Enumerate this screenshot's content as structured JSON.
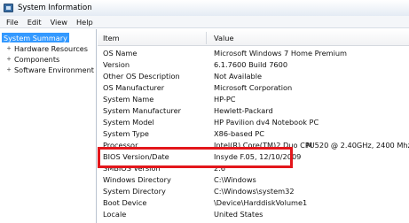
{
  "window": {
    "title": "System Information"
  },
  "menu": [
    "File",
    "Edit",
    "View",
    "Help"
  ],
  "sidebar": {
    "items": [
      {
        "label": "System Summary",
        "expander": "",
        "selected": true
      },
      {
        "label": "Hardware Resources",
        "expander": "+"
      },
      {
        "label": "Components",
        "expander": "+"
      },
      {
        "label": "Software Environment",
        "expander": "+"
      }
    ]
  },
  "table": {
    "columns": [
      "Item",
      "Value"
    ],
    "rows": [
      {
        "item": "OS Name",
        "value": "Microsoft Windows 7 Home Premium"
      },
      {
        "item": "Version",
        "value": "6.1.7600 Build 7600"
      },
      {
        "item": "Other OS Description",
        "value": "Not Available"
      },
      {
        "item": "OS Manufacturer",
        "value": "Microsoft Corporation"
      },
      {
        "item": "System Name",
        "value": "HP-PC"
      },
      {
        "item": "System Manufacturer",
        "value": "Hewlett-Packard"
      },
      {
        "item": "System Model",
        "value": "HP Pavilion dv4 Notebook PC"
      },
      {
        "item": "System Type",
        "value": "X86-based PC"
      },
      {
        "item": "Processor",
        "value": "Intel(R) Core(TM)2 Duo CPU",
        "extra": "M 520  @ 2.40GHz, 2400 Mhz,"
      },
      {
        "item": "BIOS Version/Date",
        "value": "Insyde F.05, 12/10/2009"
      },
      {
        "item": "SMBIOS Version",
        "value": "2.6"
      },
      {
        "item": "Windows Directory",
        "value": "C:\\Windows"
      },
      {
        "item": "System Directory",
        "value": "C:\\Windows\\system32"
      },
      {
        "item": "Boot Device",
        "value": "\\Device\\HarddiskVolume1"
      },
      {
        "item": "Locale",
        "value": "United States"
      }
    ]
  },
  "highlight": {
    "color": "#e3161b",
    "row_item": "BIOS Version/Date"
  }
}
